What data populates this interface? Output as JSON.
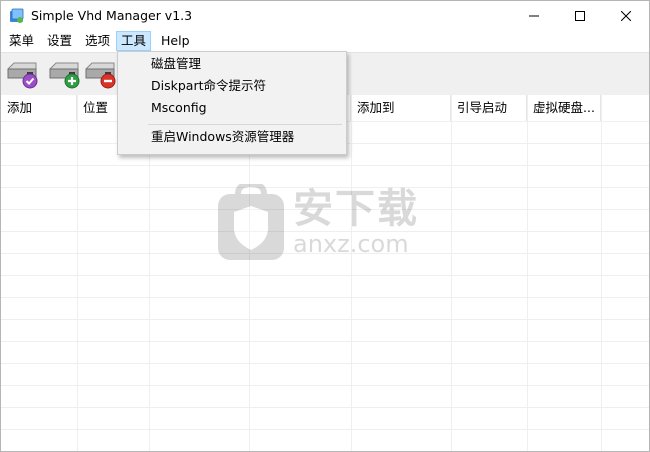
{
  "window": {
    "title": "Simple Vhd Manager v1.3",
    "icons": {
      "app": "app-icon",
      "minimize": "minimize-icon",
      "maximize": "maximize-icon",
      "close": "close-icon"
    }
  },
  "menubar": {
    "items": [
      {
        "label": "菜单"
      },
      {
        "label": "设置"
      },
      {
        "label": "选项"
      },
      {
        "label": "工具",
        "active": true
      },
      {
        "label": "Help"
      }
    ]
  },
  "toolbar": {
    "buttons": [
      {
        "icon": "disk-check-icon"
      },
      {
        "icon": "disk-add-icon"
      },
      {
        "icon": "disk-remove-icon"
      }
    ]
  },
  "tools_menu": {
    "items": [
      "磁盘管理",
      "Diskpart命令提示符",
      "Msconfig",
      "重启Windows资源管理器"
    ]
  },
  "table": {
    "columns": [
      "添加",
      "位置",
      "",
      "",
      "添加到",
      "引导启动",
      "虚拟硬盘..."
    ],
    "rows": []
  },
  "watermark": {
    "text_cn": "安下载",
    "text_en": "anxz.com",
    "icon": "shield-logo-icon"
  },
  "colors": {
    "menu_active_bg": "#cce8ff",
    "menu_active_border": "#99d1ff",
    "toolbar_bg": "#f0f0f0",
    "add_green": "#2ea043",
    "remove_red": "#d9342b",
    "check_purple": "#9b4fc6"
  }
}
